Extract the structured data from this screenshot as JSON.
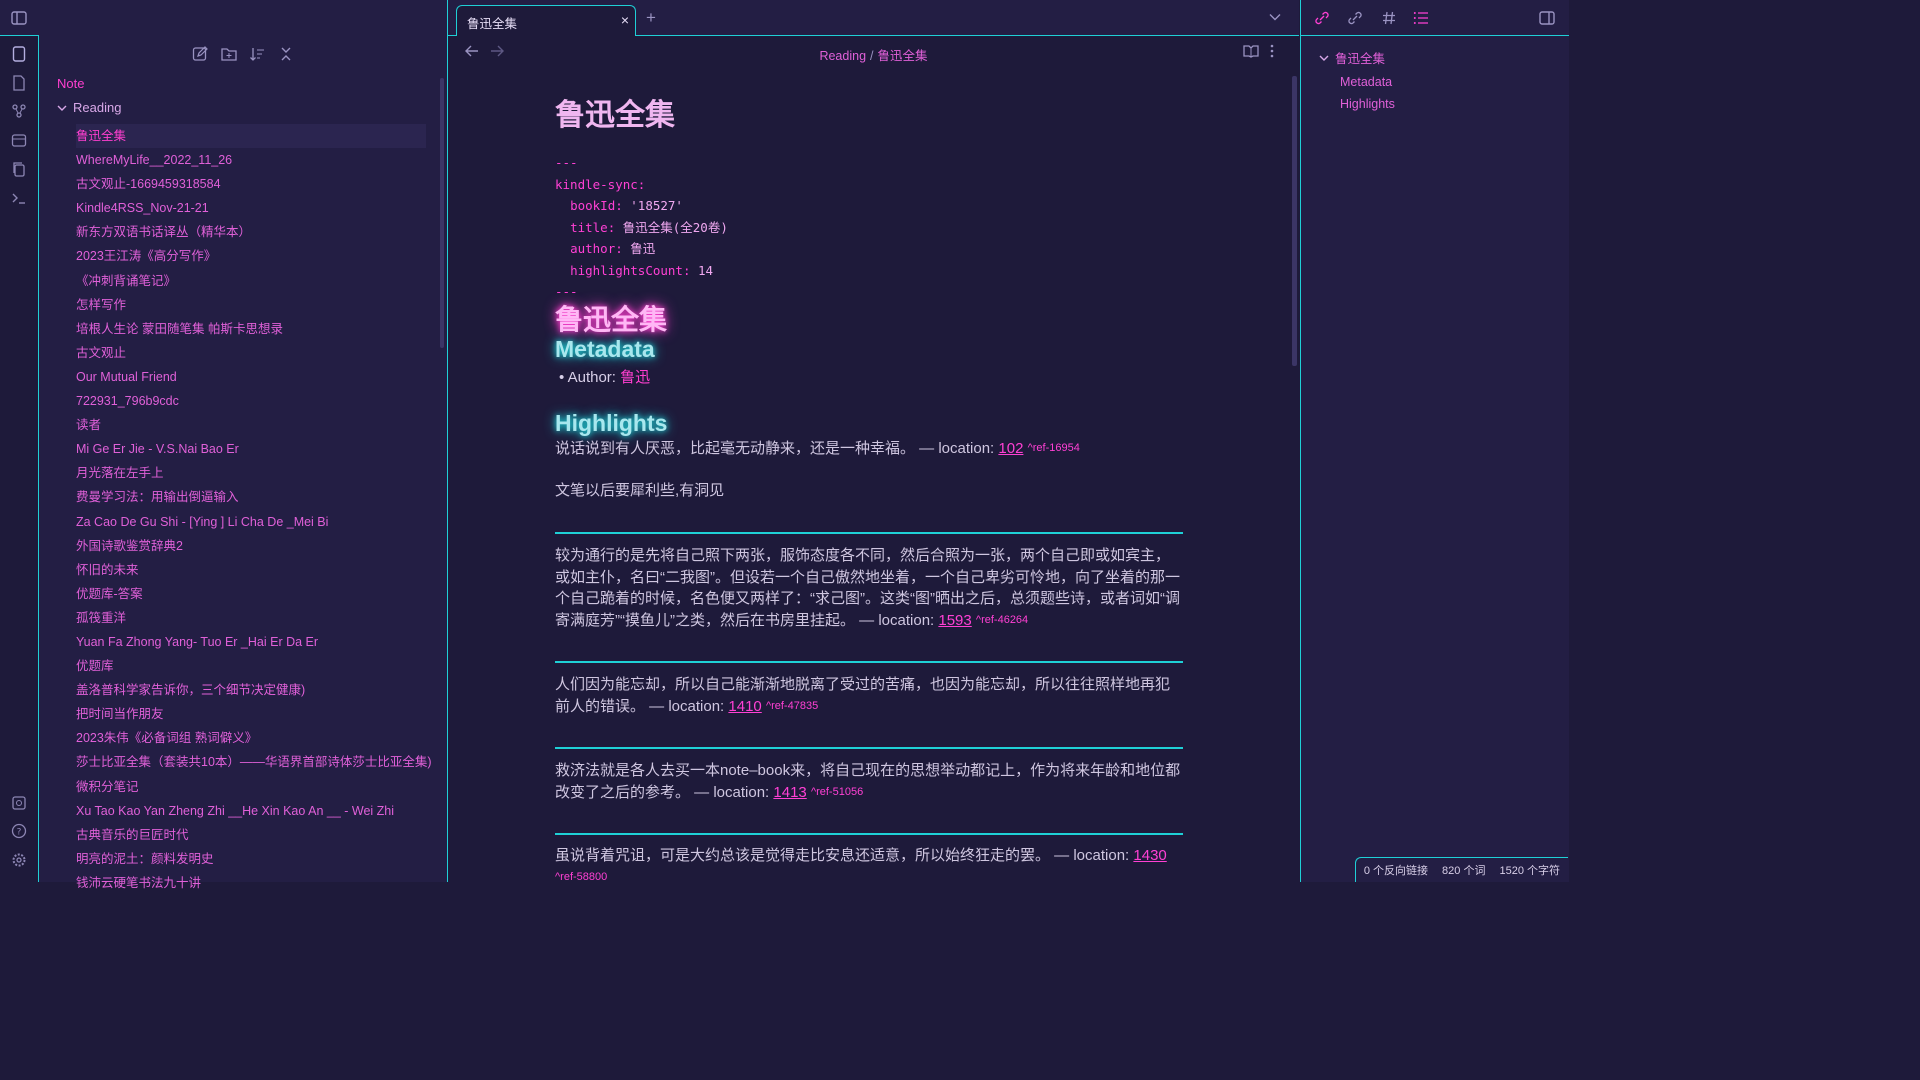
{
  "ribbon": {
    "icons": [
      "files-icon",
      "templates-icon",
      "graph-icon",
      "calendar-icon",
      "copy-icon",
      "terminal-icon"
    ],
    "bottom_icons": [
      "vault-icon",
      "help-icon",
      "settings-icon"
    ]
  },
  "sidebar": {
    "root_label": "Note",
    "folder_label": "Reading",
    "items": [
      "鲁迅全集",
      "WhereMyLife__2022_11_26",
      "古文观止-1669459318584",
      "Kindle4RSS_Nov-21-21",
      "新东方双语书话译丛（精华本）",
      "2023王江涛《高分写作》",
      "《冲刺背诵笔记》",
      "怎样写作",
      "培根人生论 蒙田随笔集 帕斯卡思想录",
      "古文观止",
      "Our Mutual Friend",
      "722931_796b9cdc",
      "读者",
      "Mi Ge Er Jie - V.S.Nai Bao Er",
      "月光落在左手上",
      "费曼学习法：用输出倒逼输入",
      "Za Cao De Gu Shi - [Ying ] Li Cha De _Mei Bi",
      "外国诗歌鉴赏辞典2",
      "怀旧的未来",
      "优题库-答案",
      "孤筏重洋",
      "Yuan Fa Zhong Yang- Tuo Er _Hai Er Da Er",
      "优题库",
      "盖洛普科学家告诉你，三个细节决定健康)",
      "把时间当作朋友",
      "2023朱伟《必备词组 熟词僻义》",
      "莎士比亚全集（套装共10本）——华语界首部诗体莎士比亚全集)",
      "微积分笔记",
      "Xu Tao Kao Yan Zheng Zhi __He Xin Kao An __ - Wei Zhi",
      "古典音乐的巨匠时代",
      "明亮的泥土：颜料发明史",
      "钱沛云硬笔书法九十讲"
    ]
  },
  "tab": {
    "title": "鲁迅全集",
    "close": "×",
    "plus": "+"
  },
  "breadcrumb": {
    "folder": "Reading",
    "sep": "/",
    "file": "鲁迅全集"
  },
  "doc": {
    "title": "鲁迅全集",
    "frontmatter": {
      "dashes": "---",
      "key": "kindle-sync:",
      "bookId_key": "bookId:",
      "bookId_val": "'18527'",
      "title_key": "title:",
      "title_val": "鲁迅全集(全20卷)",
      "author_key": "author:",
      "author_val": "鲁迅",
      "hc_key": "highlightsCount:",
      "hc_val": "14"
    },
    "h1": "鲁迅全集",
    "metadata_heading": "Metadata",
    "author_label": "Author: ",
    "author_link": "鲁迅",
    "highlights_heading": "Highlights",
    "loc_prefix": " — location: ",
    "highlights": [
      {
        "text": "说话说到有人厌恶，比起毫无动静来，还是一种幸福。",
        "loc": "102",
        "ref": "^ref-16954"
      },
      {
        "text": "较为通行的是先将自己照下两张，服饰态度各不同，然后合照为一张，两个自己即或如宾主，或如主仆，名曰“二我图”。但设若一个自己傲然地坐着，一个自己卑劣可怜地，向了坐着的那一个自己跪着的时候，名色便又两样了：“求己图”。这类“图”晒出之后，总须题些诗，或者词如“调寄满庭芳”“摸鱼儿”之类，然后在书房里挂起。",
        "loc": "1593",
        "ref": "^ref-46264"
      },
      {
        "text": "人们因为能忘却，所以自己能渐渐地脱离了受过的苦痛，也因为能忘却，所以往往照样地再犯前人的错误。",
        "loc": "1410",
        "ref": "^ref-47835"
      },
      {
        "text": "救济法就是各人去买一本note–book来，将自己现在的思想举动都记上，作为将来年龄和地位都改变了之后的参考。",
        "loc": "1413",
        "ref": "^ref-51056"
      },
      {
        "text": "虽说背着咒诅，可是大约总该是觉得走比安息还适意，所以始终狂走的罢。",
        "loc": "1430",
        "ref": "^ref-58800"
      }
    ],
    "note": "文笔以后要犀利些,有洞见"
  },
  "outline": {
    "root": "鲁迅全集",
    "items": [
      "Metadata",
      "Highlights"
    ]
  },
  "status": {
    "backlinks": "0 个反向链接",
    "words": "820 个词",
    "chars": "1520 个字符"
  }
}
